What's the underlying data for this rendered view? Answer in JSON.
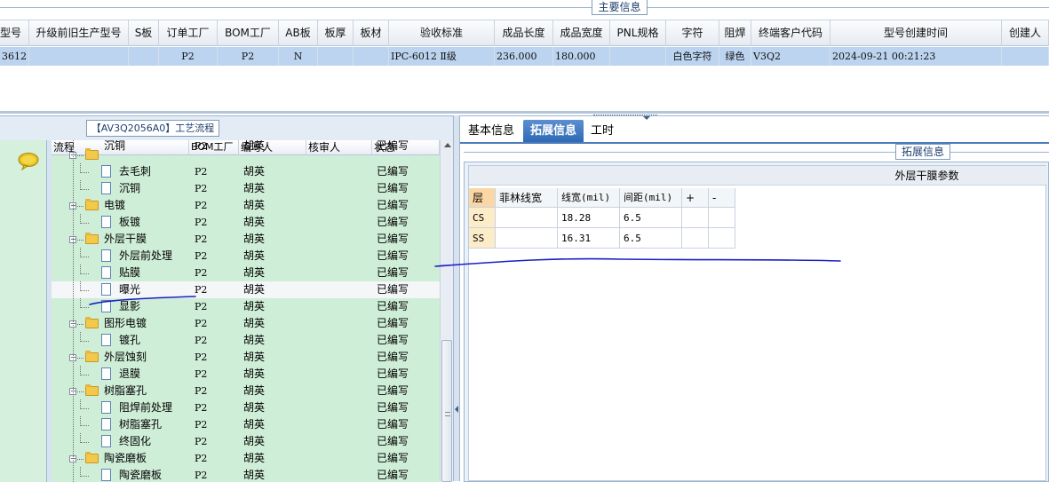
{
  "top": {
    "section_title": "主要信息",
    "columns": [
      "型号",
      "升级前旧生产型号",
      "S板",
      "订单工厂",
      "BOM工厂",
      "AB板",
      "板厚",
      "板材",
      "验收标准",
      "成品长度",
      "成品宽度",
      "PNL规格",
      "字符",
      "阻焊",
      "终端客户代码",
      "型号创建时间",
      "创建人"
    ],
    "row": [
      "3612",
      "",
      "",
      "P2",
      "P2",
      "N",
      "",
      "",
      "IPC-6012 Ⅱ级",
      "236.000",
      "180.000",
      "",
      "白色字符",
      "绿色",
      "V3Q2",
      "2024-09-21 00:21:23",
      ""
    ]
  },
  "left": {
    "process_title": "【AV3Q2056A0】工艺流程",
    "tree_columns": [
      "流程",
      "BOM工厂",
      "编写人",
      "核审人",
      "状态"
    ],
    "rows": [
      {
        "name": "沉铜",
        "bom": "P2",
        "writer": "胡英",
        "status": "已编写",
        "level": 1,
        "type": "partial"
      },
      {
        "name": "去毛刺",
        "bom": "P2",
        "writer": "胡英",
        "status": "已编写",
        "level": 2,
        "type": "doc"
      },
      {
        "name": "沉铜",
        "bom": "P2",
        "writer": "胡英",
        "status": "已编写",
        "level": 2,
        "type": "doc"
      },
      {
        "name": "电镀",
        "bom": "P2",
        "writer": "胡英",
        "status": "已编写",
        "level": 1,
        "type": "folder"
      },
      {
        "name": "板镀",
        "bom": "P2",
        "writer": "胡英",
        "status": "已编写",
        "level": 2,
        "type": "doc"
      },
      {
        "name": "外层干膜",
        "bom": "P2",
        "writer": "胡英",
        "status": "已编写",
        "level": 1,
        "type": "folder"
      },
      {
        "name": "外层前处理",
        "bom": "P2",
        "writer": "胡英",
        "status": "已编写",
        "level": 2,
        "type": "doc"
      },
      {
        "name": "贴膜",
        "bom": "P2",
        "writer": "胡英",
        "status": "已编写",
        "level": 2,
        "type": "doc"
      },
      {
        "name": "曝光",
        "bom": "P2",
        "writer": "胡英",
        "status": "已编写",
        "level": 2,
        "type": "doc",
        "selected": true
      },
      {
        "name": "显影",
        "bom": "P2",
        "writer": "胡英",
        "status": "已编写",
        "level": 2,
        "type": "doc"
      },
      {
        "name": "图形电镀",
        "bom": "P2",
        "writer": "胡英",
        "status": "已编写",
        "level": 1,
        "type": "folder"
      },
      {
        "name": "镀孔",
        "bom": "P2",
        "writer": "胡英",
        "status": "已编写",
        "level": 2,
        "type": "doc"
      },
      {
        "name": "外层蚀刻",
        "bom": "P2",
        "writer": "胡英",
        "status": "已编写",
        "level": 1,
        "type": "folder"
      },
      {
        "name": "退膜",
        "bom": "P2",
        "writer": "胡英",
        "status": "已编写",
        "level": 2,
        "type": "doc"
      },
      {
        "name": "树脂塞孔",
        "bom": "P2",
        "writer": "胡英",
        "status": "已编写",
        "level": 1,
        "type": "folder"
      },
      {
        "name": "阻焊前处理",
        "bom": "P2",
        "writer": "胡英",
        "status": "已编写",
        "level": 2,
        "type": "doc"
      },
      {
        "name": "树脂塞孔",
        "bom": "P2",
        "writer": "胡英",
        "status": "已编写",
        "level": 2,
        "type": "doc"
      },
      {
        "name": "终固化",
        "bom": "P2",
        "writer": "胡英",
        "status": "已编写",
        "level": 2,
        "type": "doc"
      },
      {
        "name": "陶瓷磨板",
        "bom": "P2",
        "writer": "胡英",
        "status": "已编写",
        "level": 1,
        "type": "folder"
      },
      {
        "name": "陶瓷磨板",
        "bom": "P2",
        "writer": "胡英",
        "status": "已编写",
        "level": 2,
        "type": "doc"
      }
    ]
  },
  "right": {
    "tabs": [
      "基本信息",
      "拓展信息",
      "工时"
    ],
    "active_tab": "拓展信息",
    "section_title": "拓展信息",
    "grid_title": "外层干膜参数",
    "param_columns": [
      "层",
      "菲林线宽",
      "线宽(mil)",
      "间距(mil)",
      "+",
      "-"
    ],
    "param_rows": [
      [
        "CS",
        "",
        "18.28",
        "6.5",
        "",
        ""
      ],
      [
        "SS",
        "",
        "16.31",
        "6.5",
        "",
        ""
      ]
    ]
  },
  "colors": {
    "selected_row": "#bcd4ef",
    "tree_bg": "#cfeed7",
    "active_tab": "#2f6ab5",
    "scribble": "#1a1fc4"
  }
}
